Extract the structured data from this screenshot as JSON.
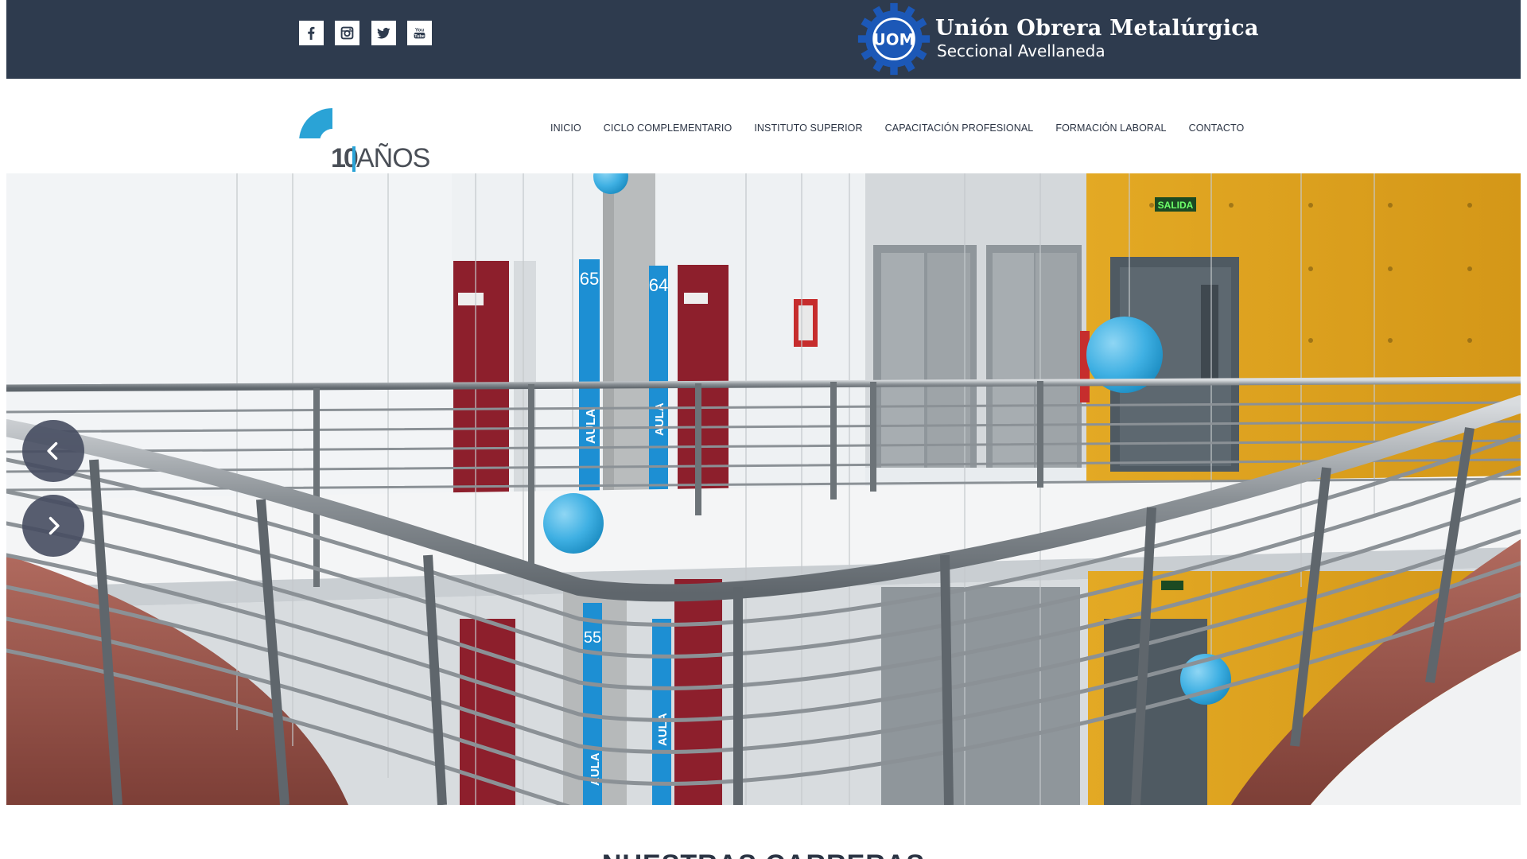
{
  "header": {
    "social": [
      {
        "icon": "facebook-icon"
      },
      {
        "icon": "instagram-icon"
      },
      {
        "icon": "twitter-icon"
      },
      {
        "icon": "youtube-icon",
        "label": "You Tube"
      }
    ],
    "org_logo": {
      "title": "Unión Obrera Metalúrgica",
      "subtitle": "Seccional Avellaneda",
      "emblem_text": "UOM",
      "emblem_color": "#1c58b7"
    },
    "bar_color": "#2e3b4e"
  },
  "brand": {
    "digits": "10",
    "years": "AÑOS",
    "accent_color": "#2aa3d6"
  },
  "nav": {
    "items": [
      {
        "label": "INICIO"
      },
      {
        "label": "CICLO COMPLEMENTARIO"
      },
      {
        "label": "INSTITUTO SUPERIOR"
      },
      {
        "label": "CAPACITACIÓN PROFESIONAL"
      },
      {
        "label": "FORMACIÓN LABORAL"
      },
      {
        "label": "CONTACTO"
      }
    ]
  },
  "hero": {
    "signs": {
      "aula": "AULA",
      "room_65": "65",
      "room_64": "64",
      "room_55": "55",
      "exit": "SALIDA"
    },
    "prev_icon": "chevron-left-icon",
    "next_icon": "chevron-right-icon"
  },
  "section": {
    "title": "NUESTRAS CARRERAS"
  }
}
